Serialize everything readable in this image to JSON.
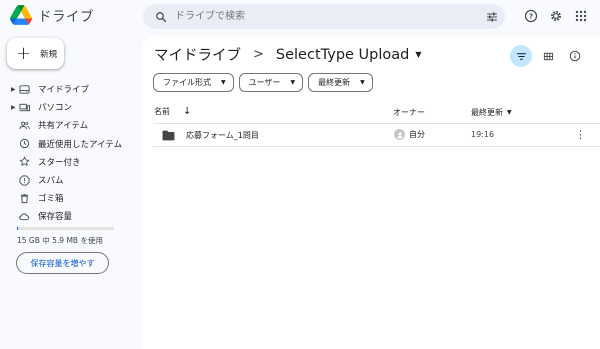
{
  "app": {
    "title": "ドライブ"
  },
  "search": {
    "placeholder": "ドライブで検索"
  },
  "sidebar": {
    "new_label": "新規",
    "items": [
      {
        "label": "マイドライブ"
      },
      {
        "label": "パソコン"
      },
      {
        "label": "共有アイテム"
      },
      {
        "label": "最近使用したアイテム"
      },
      {
        "label": "スター付き"
      },
      {
        "label": "スパム"
      },
      {
        "label": "ゴミ箱"
      },
      {
        "label": "保存容量"
      }
    ],
    "storage_text": "15 GB 中 5.9 MB を使用",
    "storage_button": "保存容量を増やす"
  },
  "breadcrumb": {
    "root": "マイドライブ",
    "separator": ">",
    "current": "SelectType Upload"
  },
  "filters": [
    {
      "label": "ファイル形式"
    },
    {
      "label": "ユーザー"
    },
    {
      "label": "最終更新"
    }
  ],
  "table": {
    "columns": {
      "name": "名前",
      "owner": "オーナー",
      "modified": "最終更新"
    },
    "rows": [
      {
        "name": "応募フォーム_1問目",
        "owner": "自分",
        "modified": "19:16"
      }
    ]
  },
  "colors": {
    "accent": "#0b57d0",
    "active_chip": "#c2e7ff",
    "background": "#f8fafd"
  },
  "icons": {
    "logo": "google-drive-logo",
    "search": "search-icon",
    "tune": "tune-icon",
    "help": "help-icon",
    "settings": "gear-icon",
    "apps": "apps-grid-icon"
  }
}
